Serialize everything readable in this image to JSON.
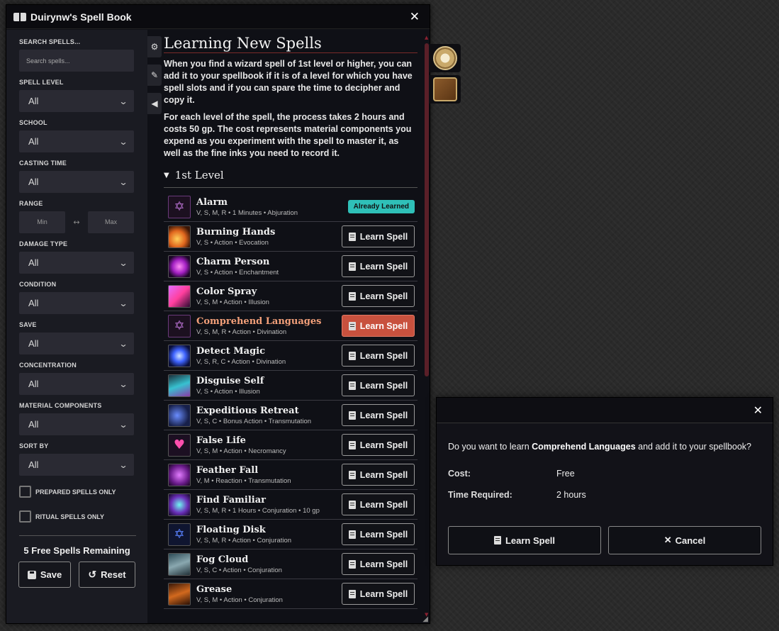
{
  "window": {
    "title": "Duirynw's Spell Book",
    "close": "✕"
  },
  "sidebar": {
    "search_label": "SEARCH SPELLS...",
    "search_placeholder": "Search spells...",
    "filters": [
      {
        "label": "SPELL LEVEL",
        "value": "All"
      },
      {
        "label": "SCHOOL",
        "value": "All"
      },
      {
        "label": "CASTING TIME",
        "value": "All"
      }
    ],
    "range": {
      "label": "RANGE",
      "min": "Min",
      "sep": "↔",
      "max": "Max"
    },
    "filters2": [
      {
        "label": "DAMAGE TYPE",
        "value": "All"
      },
      {
        "label": "CONDITION",
        "value": "All"
      },
      {
        "label": "SAVE",
        "value": "All"
      },
      {
        "label": "CONCENTRATION",
        "value": "All"
      },
      {
        "label": "MATERIAL COMPONENTS",
        "value": "All"
      },
      {
        "label": "SORT BY",
        "value": "All"
      }
    ],
    "prepared_only": "PREPARED SPELLS ONLY",
    "ritual_only": "RITUAL SPELLS ONLY",
    "remaining": "5 Free Spells Remaining",
    "save": "Save",
    "reset": "Reset"
  },
  "content": {
    "heading": "Learning New Spells",
    "para1": "When you find a wizard spell of 1st level or higher, you can add it to your spellbook if it is of a level for which you have spell slots and if you can spare the time to decipher and copy it.",
    "para2": "For each level of the spell, the process takes 2 hours and costs 50 gp. The cost represents material components you expend as you experiment with the spell to master it, as well as the fine inks you need to record it.",
    "level_heading": "1st Level",
    "learn_label": "Learn Spell",
    "learned_label": "Already Learned",
    "spells": [
      {
        "name": "Alarm",
        "meta": "V, S, M, R • 1 Minutes • Abjuration",
        "learned": true,
        "icon": "sigil"
      },
      {
        "name": "Burning Hands",
        "meta": "V, S • Action • Evocation",
        "icon": "fire"
      },
      {
        "name": "Charm Person",
        "meta": "V, S • Action • Enchantment",
        "icon": "charm"
      },
      {
        "name": "Color Spray",
        "meta": "V, S, M • Action • Illusion",
        "icon": "spray"
      },
      {
        "name": "Comprehend Languages",
        "meta": "V, S, M, R • Action • Divination",
        "icon": "sigil",
        "highlight": true
      },
      {
        "name": "Detect Magic",
        "meta": "V, S, R, C • Action • Divination",
        "icon": "detect"
      },
      {
        "name": "Disguise Self",
        "meta": "V, S • Action • Illusion",
        "icon": "disguise"
      },
      {
        "name": "Expeditious Retreat",
        "meta": "V, S, C • Bonus Action • Transmutation",
        "icon": "retreat"
      },
      {
        "name": "False Life",
        "meta": "V, S, M • Action • Necromancy",
        "icon": "heart"
      },
      {
        "name": "Feather Fall",
        "meta": "V, M • Reaction • Transmutation",
        "icon": "feather"
      },
      {
        "name": "Find Familiar",
        "meta": "V, S, M, R • 1 Hours • Conjuration • 10 gp",
        "icon": "familiar"
      },
      {
        "name": "Floating Disk",
        "meta": "V, S, M, R • Action • Conjuration",
        "icon": "sigil-blue"
      },
      {
        "name": "Fog Cloud",
        "meta": "V, S, C • Action • Conjuration",
        "icon": "fog"
      },
      {
        "name": "Grease",
        "meta": "V, S, M • Action • Conjuration",
        "icon": "grease"
      }
    ]
  },
  "dialog": {
    "close": "✕",
    "question_pre": "Do you want to learn ",
    "question_spell": "Comprehend Languages",
    "question_post": " and add it to your spellbook?",
    "cost_label": "Cost:",
    "cost_value": "Free",
    "time_label": "Time Required:",
    "time_value": "2 hours",
    "learn": "Learn Spell",
    "cancel": "Cancel"
  },
  "colors": {
    "accent_red": "#c8513e",
    "learned_teal": "#2fc0b8"
  }
}
